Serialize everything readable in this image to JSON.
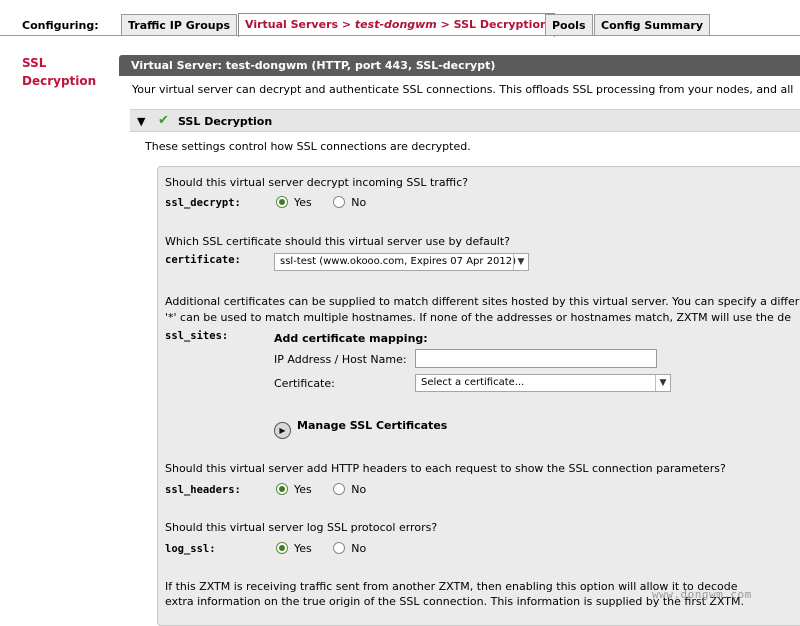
{
  "header": {
    "configuring_label": "Configuring:",
    "tabs": [
      {
        "label": "Traffic IP Groups"
      },
      {
        "label_a": "Virtual Servers > ",
        "label_b": "test-dongwm",
        "label_c": " > SSL Decryption",
        "active": true
      },
      {
        "label": "Pools"
      },
      {
        "label": "Config Summary"
      }
    ]
  },
  "left_nav": {
    "label": "SSL Decryption"
  },
  "main": {
    "server_bar": "Virtual Server: test-dongwm (HTTP, port 443, SSL-decrypt)",
    "intro": "Your virtual server can decrypt and authenticate SSL connections. This offloads SSL processing from your nodes, and all",
    "section": {
      "title": "SSL Decryption",
      "description": "These settings control how SSL connections are decrypted."
    },
    "ssl_decrypt": {
      "question": "Should this virtual server decrypt incoming SSL traffic?",
      "key": "ssl_decrypt:",
      "yes": "Yes",
      "no": "No",
      "selected": "Yes"
    },
    "certificate": {
      "question": "Which SSL certificate should this virtual server use by default?",
      "key": "certificate:",
      "value": "ssl-test (www.okooo.com, Expires 07 Apr 2012)"
    },
    "ssl_sites": {
      "text_line1": "Additional certificates can be supplied to match different sites hosted by this virtual server. You can specify a differ",
      "text_line2": "'*' can be used to match multiple hostnames. If none of the addresses or hostnames match, ZXTM will use the de",
      "key": "ssl_sites:",
      "add_mapping": "Add certificate mapping:",
      "ip_label": "IP Address / Host Name:",
      "ip_value": "",
      "cert_label": "Certificate:",
      "cert_placeholder": "Select a certificate..."
    },
    "manage_button": "Manage SSL Certificates",
    "ssl_headers": {
      "question": "Should this virtual server add HTTP headers to each request to show the SSL connection parameters?",
      "key": "ssl_headers:",
      "yes": "Yes",
      "no": "No",
      "selected": "Yes"
    },
    "log_ssl": {
      "question": "Should this virtual server log SSL protocol errors?",
      "key": "log_ssl:",
      "yes": "Yes",
      "no": "No",
      "selected": "Yes"
    },
    "footer_text_line1": "If this ZXTM is receiving traffic sent from another ZXTM, then enabling this option will allow it to decode",
    "footer_text_line2": "extra information on the true origin of the SSL connection. This information is supplied by the first ZXTM."
  },
  "watermark": "www.dongwm.com",
  "colors": {
    "accent": "#b0123a",
    "bar": "#5b5b5b",
    "radio_on": "#3e7b24"
  }
}
